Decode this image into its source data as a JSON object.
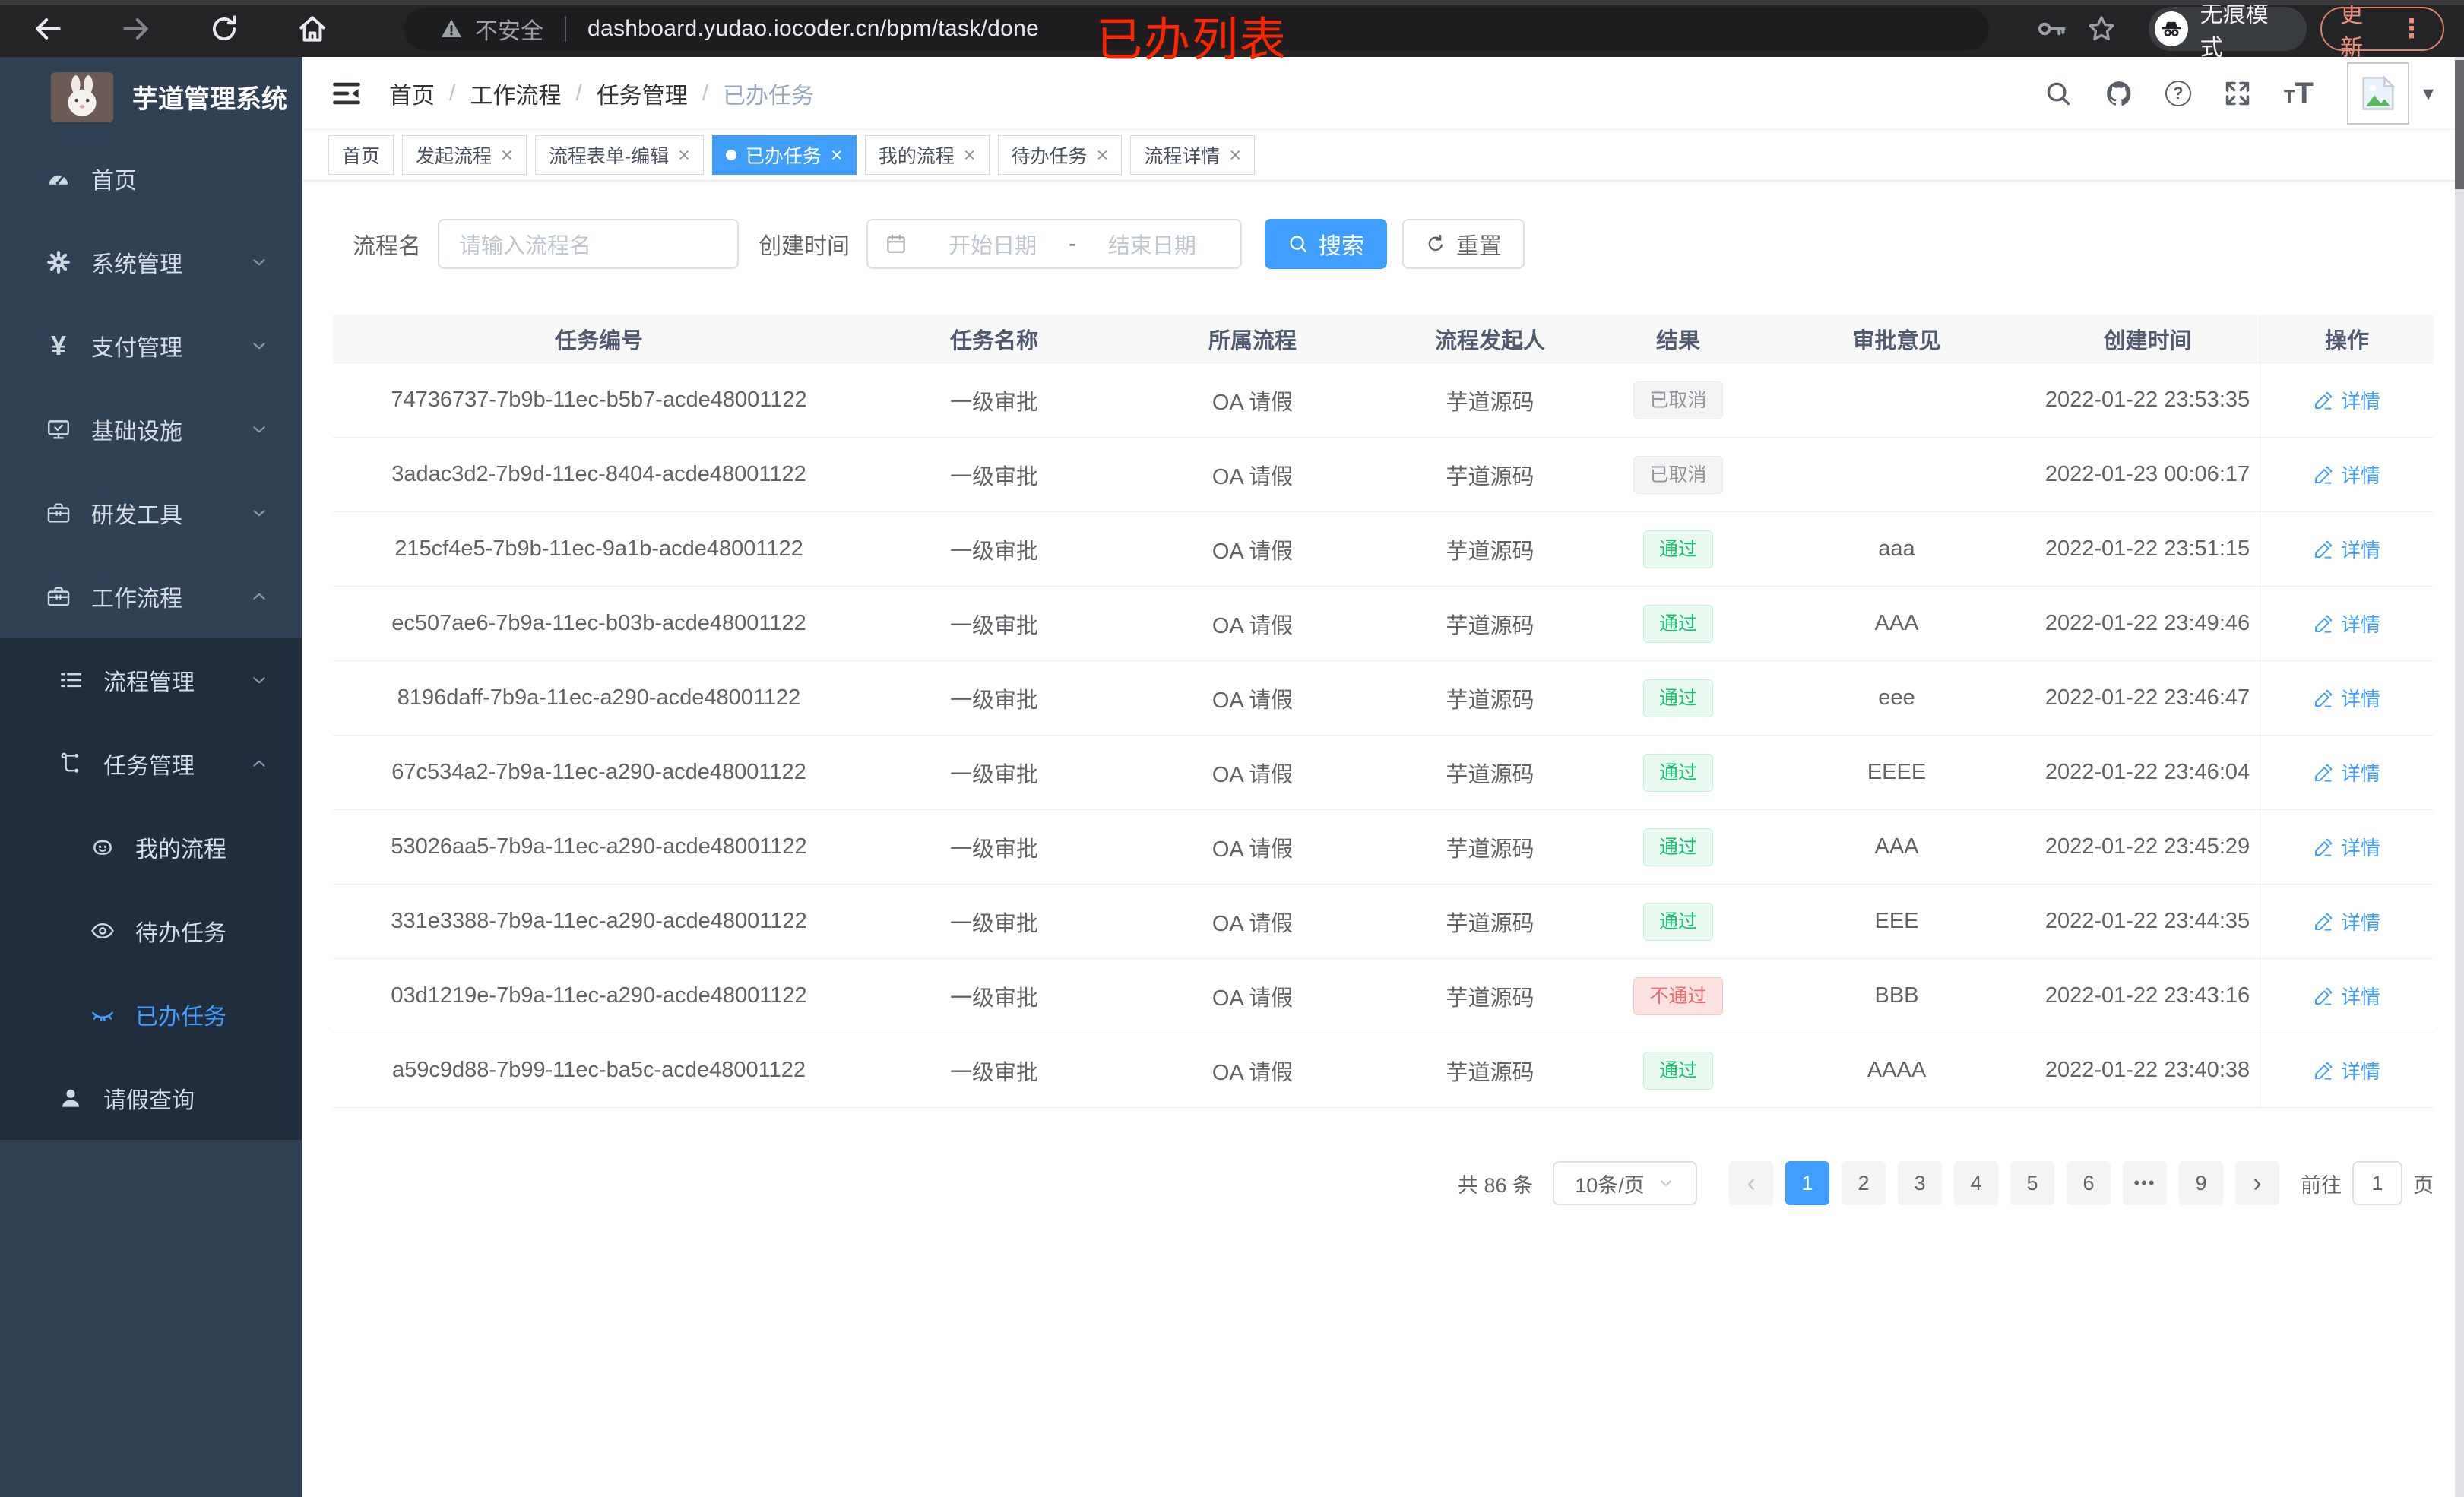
{
  "browser": {
    "security_label": "不安全",
    "url": "dashboard.yudao.iocoder.cn/bpm/task/done",
    "incognito_label": "无痕模式",
    "update_label": "更新"
  },
  "annotation": {
    "text": "已办列表"
  },
  "glyphs": {
    "close": "×",
    "more_vertical": "⋮",
    "caret_down": "▾",
    "question": "?",
    "breadcrumb_sep": "/",
    "yen": "¥",
    "page_prev": "‹",
    "page_next": "›",
    "font_letter": "T"
  },
  "sidebar": {
    "app_title": "芋道管理系统",
    "items": [
      {
        "label": "首页"
      },
      {
        "label": "系统管理"
      },
      {
        "label": "支付管理"
      },
      {
        "label": "基础设施"
      },
      {
        "label": "研发工具"
      },
      {
        "label": "工作流程"
      },
      {
        "label": "流程管理"
      },
      {
        "label": "任务管理"
      },
      {
        "label": "我的流程"
      },
      {
        "label": "待办任务"
      },
      {
        "label": "已办任务"
      },
      {
        "label": "请假查询"
      }
    ]
  },
  "header": {
    "breadcrumb": [
      "首页",
      "工作流程",
      "任务管理",
      "已办任务"
    ]
  },
  "tabs": [
    {
      "label": "首页"
    },
    {
      "label": "发起流程"
    },
    {
      "label": "流程表单-编辑"
    },
    {
      "label": "已办任务"
    },
    {
      "label": "我的流程"
    },
    {
      "label": "待办任务"
    },
    {
      "label": "流程详情"
    }
  ],
  "filters": {
    "name_label": "流程名",
    "name_placeholder": "请输入流程名",
    "time_label": "创建时间",
    "start_placeholder": "开始日期",
    "range_separator": "-",
    "end_placeholder": "结束日期",
    "search_label": "搜索",
    "reset_label": "重置"
  },
  "table": {
    "columns": [
      "任务编号",
      "任务名称",
      "所属流程",
      "流程发起人",
      "结果",
      "审批意见",
      "创建时间",
      "操作"
    ],
    "actions": {
      "detail_label": "详情"
    },
    "rows": [
      {
        "id": "74736737-7b9b-11ec-b5b7-acde48001122",
        "name": "一级审批",
        "process": "OA 请假",
        "starter": "芋道源码",
        "result": "已取消",
        "result_type": "info",
        "comment": "",
        "time": "2022-01-22 23:53:35"
      },
      {
        "id": "3adac3d2-7b9d-11ec-8404-acde48001122",
        "name": "一级审批",
        "process": "OA 请假",
        "starter": "芋道源码",
        "result": "已取消",
        "result_type": "info",
        "comment": "",
        "time": "2022-01-23 00:06:17"
      },
      {
        "id": "215cf4e5-7b9b-11ec-9a1b-acde48001122",
        "name": "一级审批",
        "process": "OA 请假",
        "starter": "芋道源码",
        "result": "通过",
        "result_type": "success",
        "comment": "aaa",
        "time": "2022-01-22 23:51:15"
      },
      {
        "id": "ec507ae6-7b9a-11ec-b03b-acde48001122",
        "name": "一级审批",
        "process": "OA 请假",
        "starter": "芋道源码",
        "result": "通过",
        "result_type": "success",
        "comment": "AAA",
        "time": "2022-01-22 23:49:46"
      },
      {
        "id": "8196daff-7b9a-11ec-a290-acde48001122",
        "name": "一级审批",
        "process": "OA 请假",
        "starter": "芋道源码",
        "result": "通过",
        "result_type": "success",
        "comment": "eee",
        "time": "2022-01-22 23:46:47"
      },
      {
        "id": "67c534a2-7b9a-11ec-a290-acde48001122",
        "name": "一级审批",
        "process": "OA 请假",
        "starter": "芋道源码",
        "result": "通过",
        "result_type": "success",
        "comment": "EEEE",
        "time": "2022-01-22 23:46:04"
      },
      {
        "id": "53026aa5-7b9a-11ec-a290-acde48001122",
        "name": "一级审批",
        "process": "OA 请假",
        "starter": "芋道源码",
        "result": "通过",
        "result_type": "success",
        "comment": "AAA",
        "time": "2022-01-22 23:45:29"
      },
      {
        "id": "331e3388-7b9a-11ec-a290-acde48001122",
        "name": "一级审批",
        "process": "OA 请假",
        "starter": "芋道源码",
        "result": "通过",
        "result_type": "success",
        "comment": "EEE",
        "time": "2022-01-22 23:44:35"
      },
      {
        "id": "03d1219e-7b9a-11ec-a290-acde48001122",
        "name": "一级审批",
        "process": "OA 请假",
        "starter": "芋道源码",
        "result": "不通过",
        "result_type": "danger",
        "comment": "BBB",
        "time": "2022-01-22 23:43:16"
      },
      {
        "id": "a59c9d88-7b99-11ec-ba5c-acde48001122",
        "name": "一级审批",
        "process": "OA 请假",
        "starter": "芋道源码",
        "result": "通过",
        "result_type": "success",
        "comment": "AAAA",
        "time": "2022-01-22 23:40:38"
      }
    ]
  },
  "pagination": {
    "total_label": "共 86 条",
    "page_size": "10条/页",
    "pages": [
      "1",
      "2",
      "3",
      "4",
      "5",
      "6",
      "•••",
      "9"
    ],
    "active_page": "1",
    "goto_label": "前往",
    "goto_value": "1",
    "page_unit": "页"
  },
  "colors": {
    "accent": "#409eff",
    "success": "#16c06d",
    "danger": "#f56c6c",
    "info": "#909399",
    "sidebar_bg": "#304156",
    "submenu_bg": "#1f2d3d",
    "update_button": "#ef8b75",
    "annotation": "#ff2400"
  }
}
